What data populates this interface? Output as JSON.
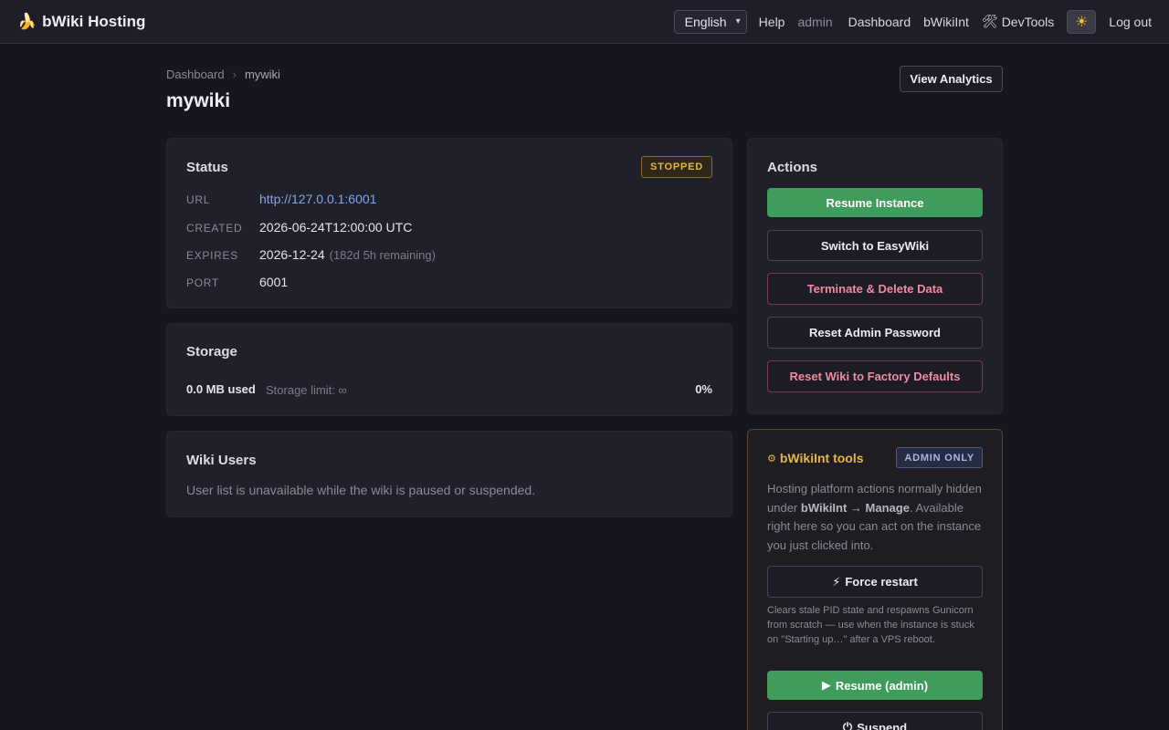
{
  "navbar": {
    "brand_icon": "🍌",
    "brand": "bWiki Hosting",
    "language": "English",
    "links": {
      "help": "Help",
      "user": "admin",
      "dashboard": "Dashboard",
      "bwikiint": "bWikiInt",
      "devtools": "DevTools",
      "devtools_icon": "🛠",
      "theme_icon": "☀",
      "logout": "Log out"
    }
  },
  "header": {
    "breadcrumb": [
      "Dashboard",
      "›",
      "mywiki"
    ],
    "title": "mywiki",
    "analytics_button": "View Analytics"
  },
  "status": {
    "heading": "Status",
    "badge": "STOPPED",
    "rows": {
      "url": {
        "key": "URL",
        "value": "http://127.0.0.1:6001"
      },
      "created": {
        "key": "CREATED",
        "value": "2026-06-24T12:00:00 UTC"
      },
      "expires": {
        "key": "EXPIRES",
        "value": "2026-12-24",
        "note": "(182d 5h remaining)"
      },
      "port": {
        "key": "PORT",
        "value": "6001"
      }
    }
  },
  "storage": {
    "heading": "Storage",
    "used": "0.0 MB used",
    "limit": "Storage limit: ∞",
    "percent": "0%"
  },
  "users": {
    "heading": "Wiki Users",
    "message": "User list is unavailable while the wiki is paused or suspended."
  },
  "actions": {
    "heading": "Actions",
    "resume": "Resume Instance",
    "switch": "Switch to EasyWiki",
    "terminate": "Terminate & Delete Data",
    "reset_password": "Reset Admin Password",
    "reset_factory": "Reset Wiki to Factory Defaults"
  },
  "tools": {
    "gear_icon": "⚙",
    "title": "bWikiInt tools",
    "badge": "ADMIN ONLY",
    "desc_1": "Hosting platform actions normally hidden under ",
    "desc_bold": "bWikiInt → Manage",
    "desc_2": ". Available right here so you can act on the instance you just clicked into.",
    "force_icon": "⚡",
    "force_restart": "Force restart",
    "restart_note": "Clears stale PID state and respawns Gunicorn from scratch — use when the instance is stuck on \"Starting up…\" after a VPS reboot.",
    "resume_icon": "▶",
    "resume_admin": "Resume (admin)",
    "suspend_icon": "⏻",
    "suspend": "Suspend"
  },
  "colors": {
    "background": "#16161e",
    "card": "#20202a",
    "accent_green": "#3f9c5a",
    "danger": "#f08aa0",
    "warning": "#e6b54a",
    "link": "#7fa6f0"
  }
}
